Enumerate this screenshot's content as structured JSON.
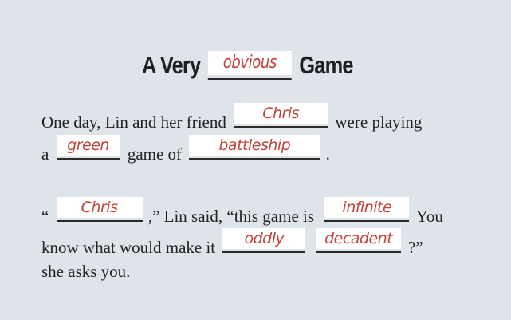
{
  "title": {
    "before": "A Very",
    "blank": "obvious",
    "after": "Game"
  },
  "paragraph1": {
    "line1_part1": "One day, Lin and her friend",
    "blank_friend": "Chris",
    "line1_part2": "were playing",
    "line2_part1": "a",
    "blank_adjective": "green",
    "line2_part2": "game of",
    "blank_game": "battleship",
    "line2_part3": "."
  },
  "paragraph2": {
    "line1_part1": "“",
    "blank_name": "Chris",
    "line1_part2": ",” Lin said, “this game is",
    "blank_adj": "infinite",
    "line1_part3": "You",
    "line2_part1": "know what would make it",
    "blank_adverb": "oddly",
    "blank_adj2": "decadent",
    "line2_part2": "?”",
    "line3": "she asks you."
  },
  "colors": {
    "background": "#dfe3ea",
    "handwriting": "#c2433a",
    "text": "#222222"
  }
}
